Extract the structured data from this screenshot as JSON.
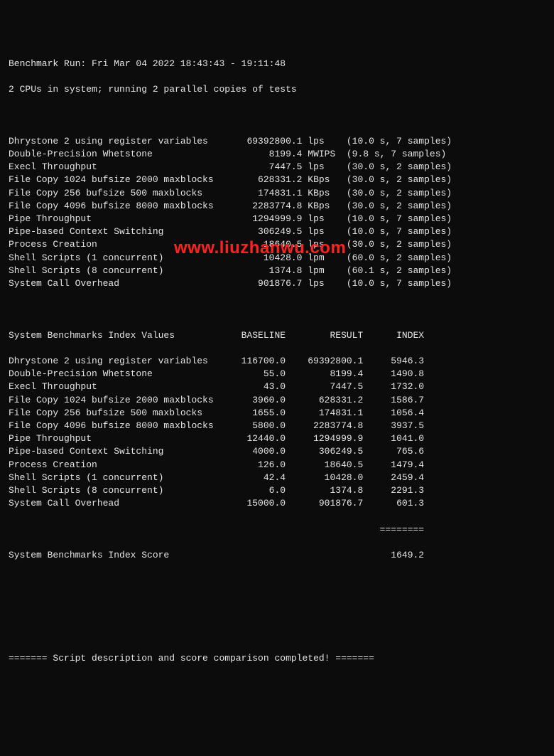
{
  "header": {
    "run_line": "Benchmark Run: Fri Mar 04 2022 18:43:43 - 19:11:48",
    "cpu_line": "2 CPUs in system; running 2 parallel copies of tests"
  },
  "results": [
    {
      "name": "Dhrystone 2 using register variables",
      "value": "69392800.1",
      "unit": "lps",
      "timing": "(10.0 s, 7 samples)"
    },
    {
      "name": "Double-Precision Whetstone",
      "value": "8199.4",
      "unit": "MWIPS",
      "timing": "(9.8 s, 7 samples)"
    },
    {
      "name": "Execl Throughput",
      "value": "7447.5",
      "unit": "lps",
      "timing": "(30.0 s, 2 samples)"
    },
    {
      "name": "File Copy 1024 bufsize 2000 maxblocks",
      "value": "628331.2",
      "unit": "KBps",
      "timing": "(30.0 s, 2 samples)"
    },
    {
      "name": "File Copy 256 bufsize 500 maxblocks",
      "value": "174831.1",
      "unit": "KBps",
      "timing": "(30.0 s, 2 samples)"
    },
    {
      "name": "File Copy 4096 bufsize 8000 maxblocks",
      "value": "2283774.8",
      "unit": "KBps",
      "timing": "(30.0 s, 2 samples)"
    },
    {
      "name": "Pipe Throughput",
      "value": "1294999.9",
      "unit": "lps",
      "timing": "(10.0 s, 7 samples)"
    },
    {
      "name": "Pipe-based Context Switching",
      "value": "306249.5",
      "unit": "lps",
      "timing": "(10.0 s, 7 samples)"
    },
    {
      "name": "Process Creation",
      "value": "18640.5",
      "unit": "lps",
      "timing": "(30.0 s, 2 samples)"
    },
    {
      "name": "Shell Scripts (1 concurrent)",
      "value": "10428.0",
      "unit": "lpm",
      "timing": "(60.0 s, 2 samples)"
    },
    {
      "name": "Shell Scripts (8 concurrent)",
      "value": "1374.8",
      "unit": "lpm",
      "timing": "(60.1 s, 2 samples)"
    },
    {
      "name": "System Call Overhead",
      "value": "901876.7",
      "unit": "lps",
      "timing": "(10.0 s, 7 samples)"
    }
  ],
  "index_header": {
    "title": "System Benchmarks Index Values",
    "col1": "BASELINE",
    "col2": "RESULT",
    "col3": "INDEX"
  },
  "index": [
    {
      "name": "Dhrystone 2 using register variables",
      "baseline": "116700.0",
      "result": "69392800.1",
      "index": "5946.3"
    },
    {
      "name": "Double-Precision Whetstone",
      "baseline": "55.0",
      "result": "8199.4",
      "index": "1490.8"
    },
    {
      "name": "Execl Throughput",
      "baseline": "43.0",
      "result": "7447.5",
      "index": "1732.0"
    },
    {
      "name": "File Copy 1024 bufsize 2000 maxblocks",
      "baseline": "3960.0",
      "result": "628331.2",
      "index": "1586.7"
    },
    {
      "name": "File Copy 256 bufsize 500 maxblocks",
      "baseline": "1655.0",
      "result": "174831.1",
      "index": "1056.4"
    },
    {
      "name": "File Copy 4096 bufsize 8000 maxblocks",
      "baseline": "5800.0",
      "result": "2283774.8",
      "index": "3937.5"
    },
    {
      "name": "Pipe Throughput",
      "baseline": "12440.0",
      "result": "1294999.9",
      "index": "1041.0"
    },
    {
      "name": "Pipe-based Context Switching",
      "baseline": "4000.0",
      "result": "306249.5",
      "index": "765.6"
    },
    {
      "name": "Process Creation",
      "baseline": "126.0",
      "result": "18640.5",
      "index": "1479.4"
    },
    {
      "name": "Shell Scripts (1 concurrent)",
      "baseline": "42.4",
      "result": "10428.0",
      "index": "2459.4"
    },
    {
      "name": "Shell Scripts (8 concurrent)",
      "baseline": "6.0",
      "result": "1374.8",
      "index": "2291.3"
    },
    {
      "name": "System Call Overhead",
      "baseline": "15000.0",
      "result": "901876.7",
      "index": "601.3"
    }
  ],
  "index_sep": "                                                                   ========",
  "score": {
    "label": "System Benchmarks Index Score",
    "value": "1649.2"
  },
  "footer": "======= Script description and score comparison completed! =======",
  "watermark": "www.liuzhanwu.com"
}
